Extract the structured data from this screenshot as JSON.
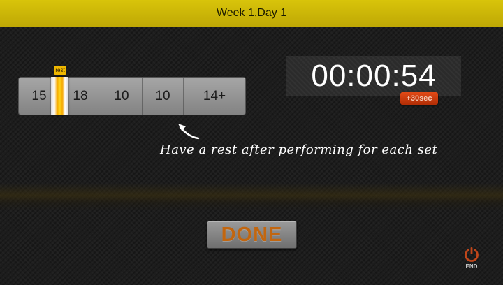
{
  "header": {
    "title": "Week 1,Day 1"
  },
  "sets": {
    "rest_tab_label": "rest",
    "items": [
      "15",
      "18",
      "10",
      "10",
      "14+"
    ]
  },
  "timer": {
    "value": "00:00:54",
    "add_button_label": "+30sec"
  },
  "hint": {
    "text": "Have a rest after performing for each set"
  },
  "actions": {
    "done_label": "DONE",
    "end_label": "END"
  },
  "colors": {
    "header": "#c9b508",
    "accent": "#c2660f",
    "add_button": "#d13d10",
    "end_icon": "#c0461a"
  },
  "icons": {
    "hint_arrow": "curved-arrow-icon",
    "end": "power-icon"
  }
}
